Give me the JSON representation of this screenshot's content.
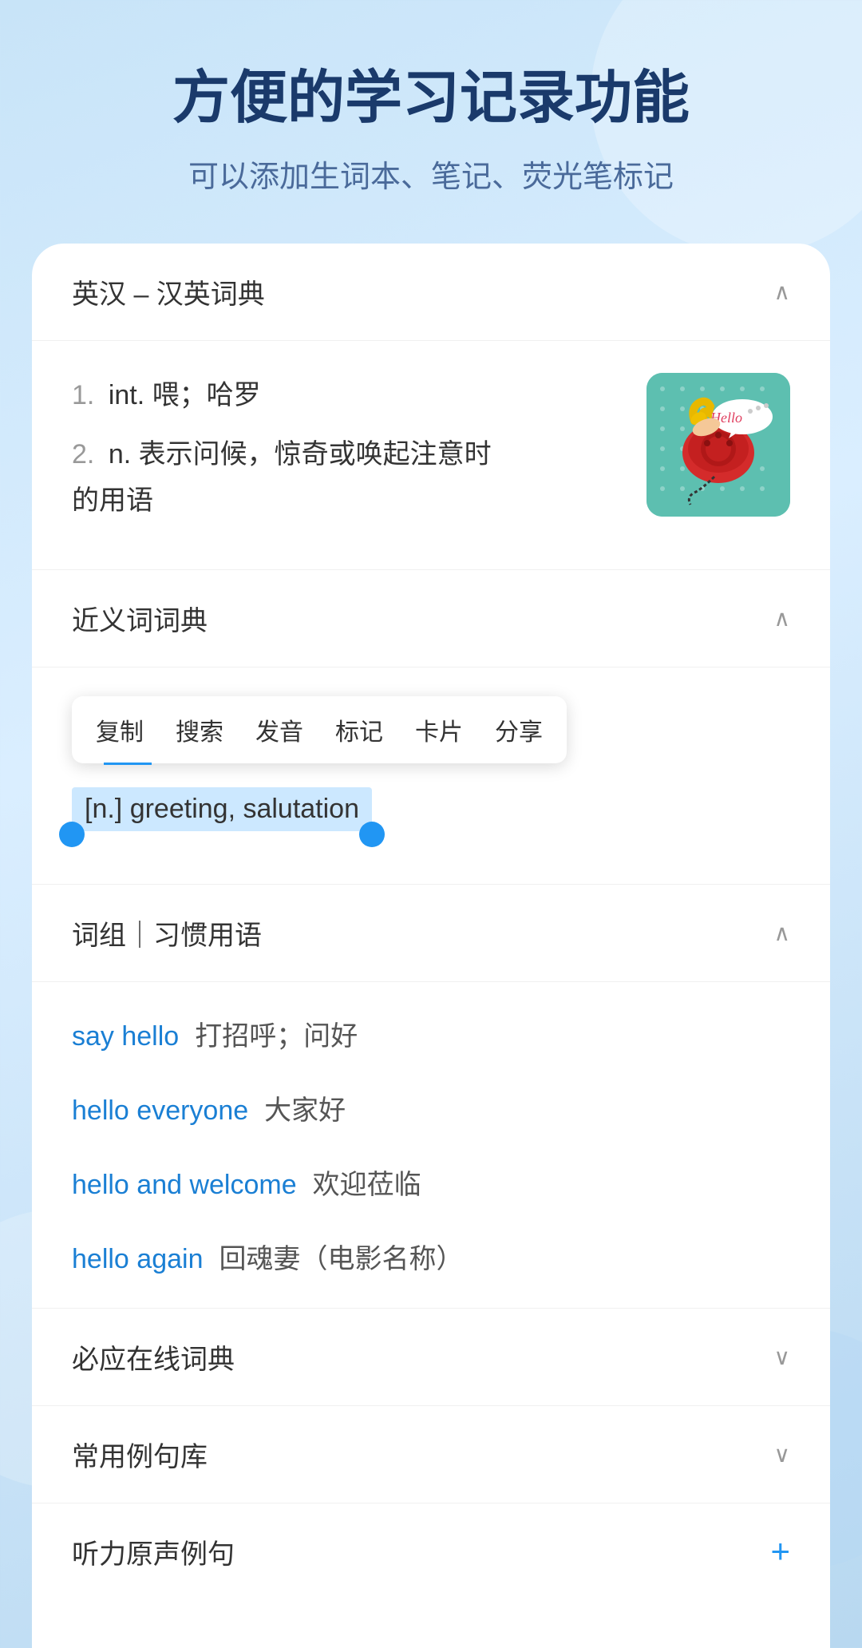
{
  "header": {
    "title": "方便的学习记录功能",
    "subtitle": "可以添加生词本、笔记、荧光笔标记"
  },
  "dictionary_section": {
    "label": "英汉 – 汉英词典",
    "chevron": "^",
    "definitions": [
      {
        "number": "1.",
        "type": "int.",
        "meaning": "喂；哈罗"
      },
      {
        "number": "2.",
        "type": "n.",
        "meaning": "表示问候，惊奇或唤起注意时的用语"
      }
    ]
  },
  "synonym_section": {
    "label": "近义词词典",
    "chevron": "^",
    "context_menu": {
      "items": [
        "复制",
        "搜索",
        "发音",
        "标记",
        "卡片",
        "分享"
      ]
    },
    "selected_text": "[n.] greeting, salutation"
  },
  "phrases_section": {
    "label": "词组｜习惯用语",
    "chevron": "^",
    "items": [
      {
        "english": "say hello",
        "chinese": "打招呼；问好"
      },
      {
        "english": "hello everyone",
        "chinese": "大家好"
      },
      {
        "english": "hello and welcome",
        "chinese": "欢迎莅临"
      },
      {
        "english": "hello again",
        "chinese": "回魂妻（电影名称）"
      }
    ]
  },
  "collapsed_sections": [
    {
      "label": "必应在线词典",
      "icon": "chevron-down"
    },
    {
      "label": "常用例句库",
      "icon": "chevron-down"
    }
  ],
  "last_section": {
    "label": "听力原声例句",
    "icon": "plus"
  }
}
